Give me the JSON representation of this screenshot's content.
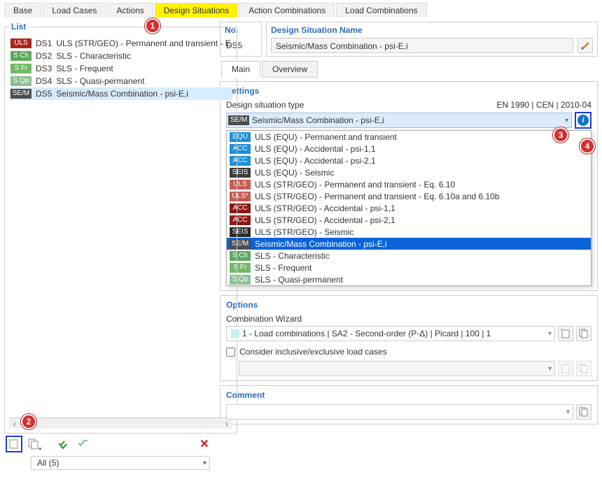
{
  "tabs": [
    {
      "label": "Base"
    },
    {
      "label": "Load Cases"
    },
    {
      "label": "Actions"
    },
    {
      "label": "Design Situations"
    },
    {
      "label": "Action Combinations"
    },
    {
      "label": "Load Combinations"
    }
  ],
  "list_title": "List",
  "list_rows": [
    {
      "tag": "ULS",
      "color": "#b0241a",
      "code": "DS1",
      "name": "ULS (STR/GEO) - Permanent and transient - E"
    },
    {
      "tag": "S Ch",
      "color": "#5ea85c",
      "code": "DS2",
      "name": "SLS - Characteristic"
    },
    {
      "tag": "S Fr",
      "color": "#74b867",
      "code": "DS3",
      "name": "SLS - Frequent"
    },
    {
      "tag": "S Qp",
      "color": "#8bbf93",
      "code": "DS4",
      "name": "SLS - Quasi-permanent"
    },
    {
      "tag": "SE/M",
      "color": "#4d4d4d",
      "code": "DS5",
      "name": "Seismic/Mass Combination - psi-E,i"
    }
  ],
  "left_filter": "All (5)",
  "no_label": "No.",
  "no_value": "DS5",
  "name_label": "Design Situation Name",
  "name_value": "Seismic/Mass Combination - psi-E,i",
  "subtabs": {
    "main": "Main",
    "overview": "Overview"
  },
  "settings_title": "Settings",
  "design_type_label": "Design situation type",
  "standard_label": "EN 1990 | CEN | 2010-04",
  "combo_value": {
    "tag": "SE/M",
    "color": "#4d4d4d",
    "text": "Seismic/Mass Combination - psi-E,i"
  },
  "dd_items": [
    {
      "tag": "EQU",
      "color": "#1c8fd6",
      "text": "ULS (EQU) - Permanent and transient"
    },
    {
      "tag": "ACC",
      "color": "#1c8fd6",
      "text": "ULS (EQU) - Accidental - psi-1,1"
    },
    {
      "tag": "ACC",
      "color": "#1c8fd6",
      "text": "ULS (EQU) - Accidental - psi-2,1"
    },
    {
      "tag": "SEIS",
      "color": "#3a3a3a",
      "text": "ULS (EQU) - Seismic"
    },
    {
      "tag": "ULS",
      "color": "#c45b52",
      "text": "ULS (STR/GEO) - Permanent and transient - Eq. 6.10"
    },
    {
      "tag": "ULS*",
      "color": "#c45b52",
      "text": "ULS (STR/GEO) - Permanent and transient - Eq. 6.10a and 6.10b"
    },
    {
      "tag": "ACC",
      "color": "#8b1a16",
      "text": "ULS (STR/GEO) - Accidental - psi-1,1"
    },
    {
      "tag": "ACC",
      "color": "#8b1a16",
      "text": "ULS (STR/GEO) - Accidental - psi-2,1"
    },
    {
      "tag": "SEIS",
      "color": "#2a2a2a",
      "text": "ULS (STR/GEO) - Seismic"
    },
    {
      "tag": "SE/M",
      "color": "#4d4d4d",
      "text": "Seismic/Mass Combination - psi-E,i",
      "selected": true
    },
    {
      "tag": "S Ch",
      "color": "#5ea85c",
      "text": "SLS - Characteristic"
    },
    {
      "tag": "S Fr",
      "color": "#74b867",
      "text": "SLS - Frequent"
    },
    {
      "tag": "S Qp",
      "color": "#8bbf93",
      "text": "SLS - Quasi-permanent"
    }
  ],
  "options_title": "Options",
  "combination_wizard_label": "Combination Wizard",
  "combination_wizard_value": "1 - Load combinations | SA2 - Second-order (P-Δ) | Picard | 100 | 1",
  "consider_label": "Consider inclusive/exclusive load cases",
  "comment_title": "Comment",
  "callouts": {
    "c1": "1",
    "c2": "2",
    "c3": "3",
    "c4": "4"
  }
}
